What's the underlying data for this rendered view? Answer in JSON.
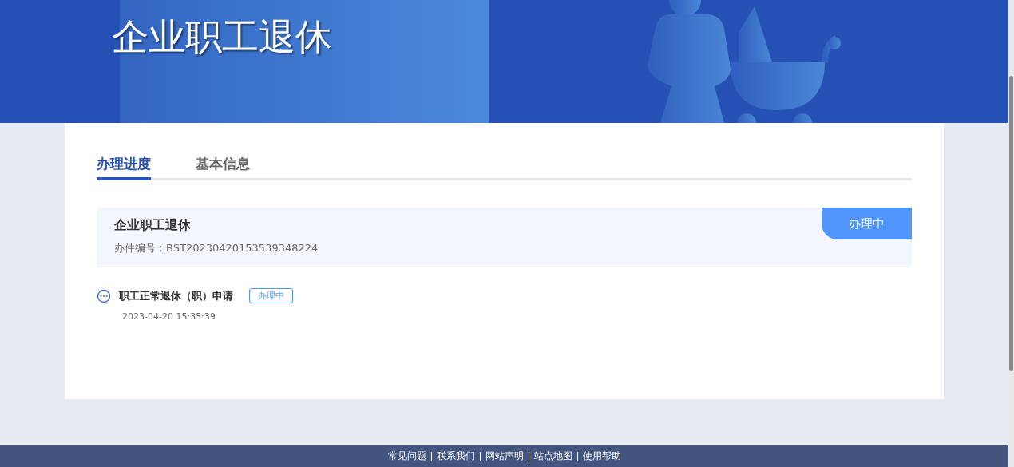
{
  "banner": {
    "title": "企业职工退休"
  },
  "tabs": [
    {
      "label": "办理进度",
      "selected": true
    },
    {
      "label": "基本信息",
      "selected": false
    }
  ],
  "case": {
    "title": "企业职工退休",
    "number_label": "办件编号：",
    "number": "BST20230420153539348224",
    "status": "办理中"
  },
  "timeline": [
    {
      "title": "职工正常退休（职）申请",
      "status": "办理中",
      "time": "2023-04-20 15:35:39"
    }
  ],
  "footer_links": [
    "常见问题",
    "联系我们",
    "网站声明",
    "站点地图",
    "使用帮助"
  ]
}
